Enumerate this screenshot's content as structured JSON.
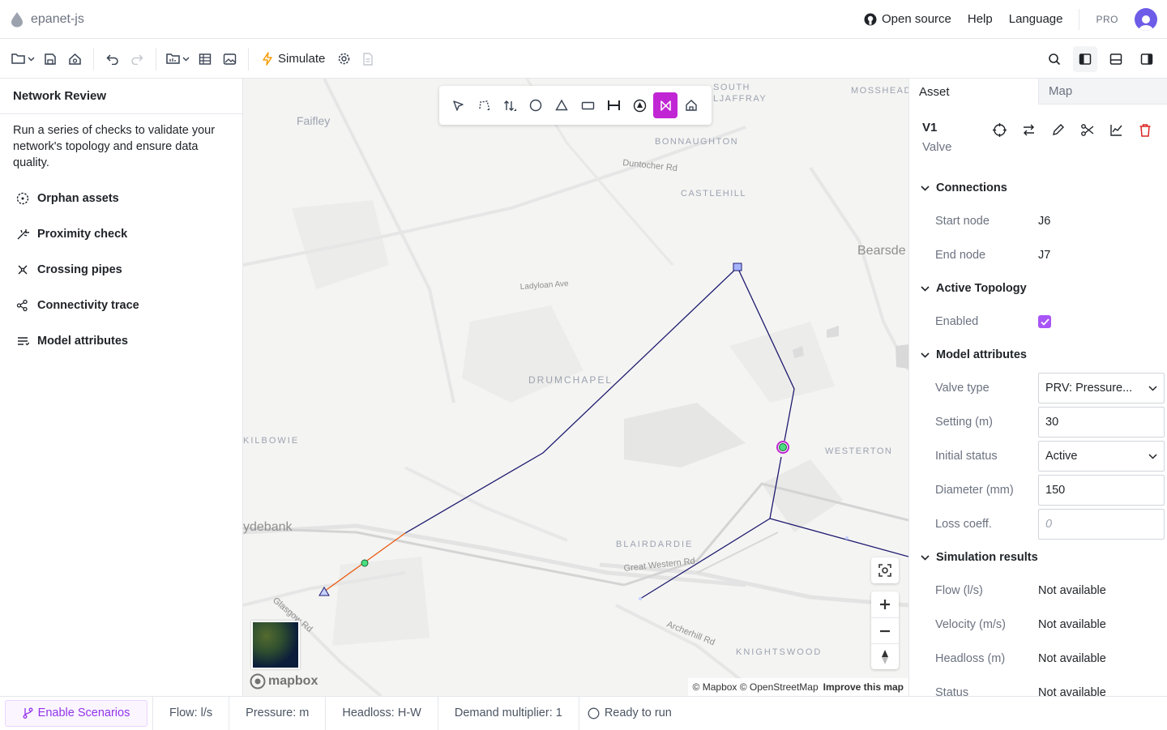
{
  "app": {
    "name": "epanet-js"
  },
  "topnav": {
    "open_source": "Open source",
    "help": "Help",
    "language": "Language",
    "plan": "PRO"
  },
  "toolbar": {
    "simulate": "Simulate"
  },
  "left_panel": {
    "title": "Network Review",
    "description": "Run a series of checks to validate your network's topology and ensure data quality.",
    "items": [
      {
        "label": "Orphan assets",
        "icon": "orphan-icon"
      },
      {
        "label": "Proximity check",
        "icon": "proximity-icon"
      },
      {
        "label": "Crossing pipes",
        "icon": "crossing-icon"
      },
      {
        "label": "Connectivity trace",
        "icon": "connectivity-icon"
      },
      {
        "label": "Model attributes",
        "icon": "attributes-icon"
      }
    ]
  },
  "map": {
    "labels": [
      "Faifley",
      "SOUTH",
      "LJAFFRAY",
      "MOSSHEAD",
      "BONNAUGHTON",
      "Duntocher Rd",
      "CASTLEHILL",
      "Bearsde",
      "Ladyloan Ave",
      "DRUMCHAPEL",
      "KILBOWIE",
      "WESTERTON",
      "ydebank",
      "BLAIRDARDIE",
      "Great Western Rd",
      "Glasgow Rd",
      "Archerhill Rd",
      "KNIGHTSWOOD"
    ],
    "attribution": "© Mapbox © OpenStreetMap",
    "improve": "Improve this map",
    "logo": "mapbox"
  },
  "right_panel": {
    "tabs": [
      "Asset",
      "Map"
    ],
    "asset_id": "V1",
    "asset_type": "Valve",
    "sections": {
      "connections": "Connections",
      "active_topology": "Active Topology",
      "model_attributes": "Model attributes",
      "simulation_results": "Simulation results"
    },
    "connections": {
      "start_label": "Start node",
      "start_value": "J6",
      "end_label": "End node",
      "end_value": "J7"
    },
    "topology": {
      "enabled_label": "Enabled",
      "enabled": true
    },
    "attributes": {
      "valve_type_label": "Valve type",
      "valve_type": "PRV: Pressure...",
      "setting_label": "Setting (m)",
      "setting": "30",
      "initial_status_label": "Initial status",
      "initial_status": "Active",
      "diameter_label": "Diameter (mm)",
      "diameter": "150",
      "loss_label": "Loss coeff.",
      "loss_placeholder": "0"
    },
    "results": {
      "flow_label": "Flow (l/s)",
      "flow": "Not available",
      "velocity_label": "Velocity (m/s)",
      "velocity": "Not available",
      "headloss_label": "Headloss (m)",
      "headloss": "Not available",
      "status_label": "Status",
      "status": "Not available"
    }
  },
  "footer": {
    "scenarios": "Enable Scenarios",
    "flow": "Flow: l/s",
    "pressure": "Pressure: m",
    "headloss": "Headloss: H-W",
    "demand": "Demand multiplier: 1",
    "status": "Ready to run"
  },
  "colors": {
    "accent": "#a855f7",
    "pipe": "#1e1b6e",
    "selected_pipe": "#ea580c",
    "active_tool": "#c026d3"
  }
}
